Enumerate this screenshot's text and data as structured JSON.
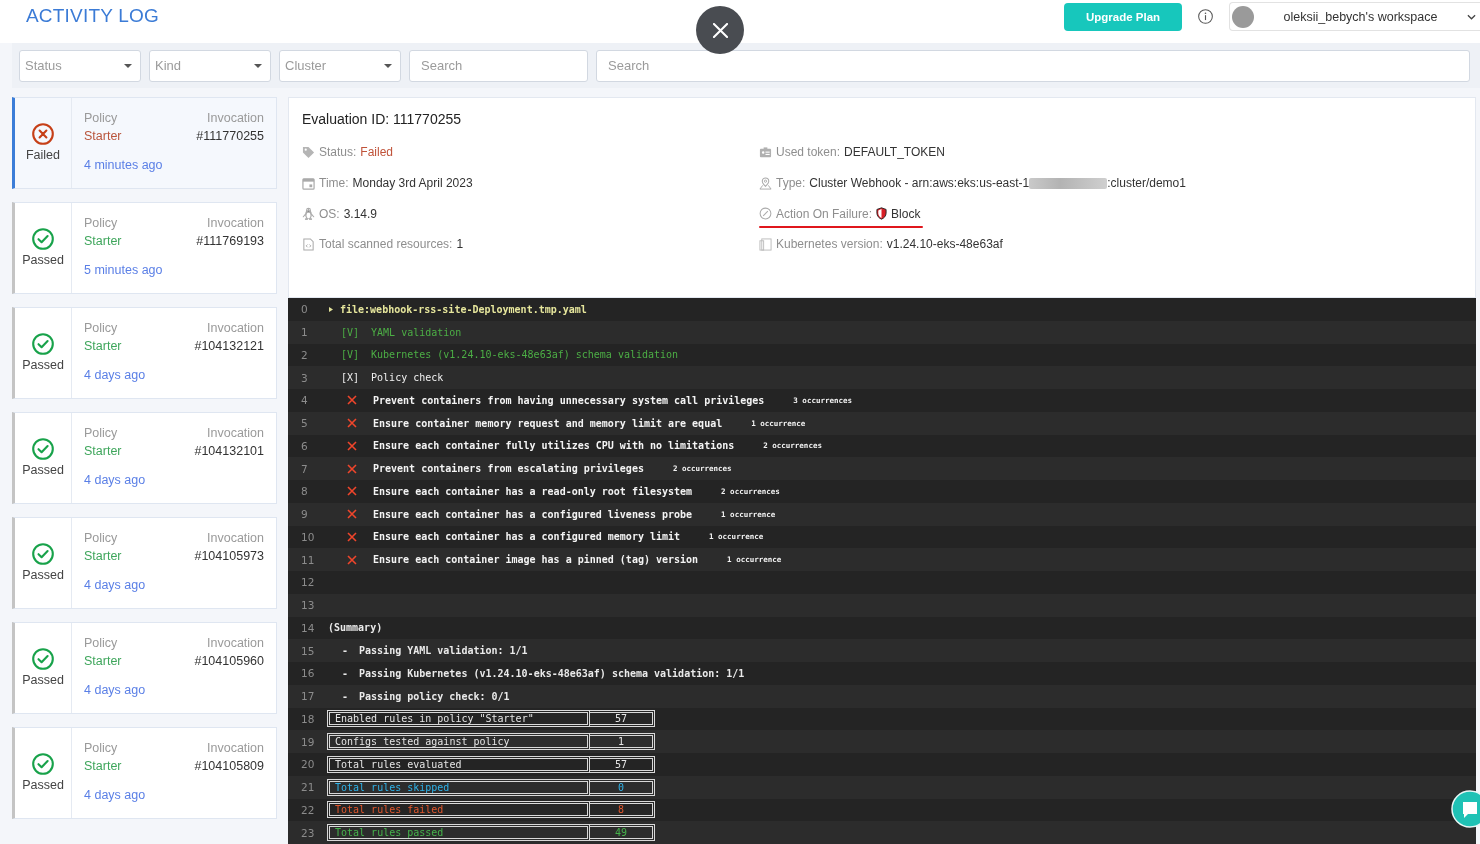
{
  "header": {
    "title": "ACTIVITY LOG",
    "upgrade_button": "Upgrade Plan",
    "workspace": "oleksii_bebych's workspace"
  },
  "filters": [
    {
      "kind": "select",
      "placeholder": "Status"
    },
    {
      "kind": "select",
      "placeholder": "Kind"
    },
    {
      "kind": "select",
      "placeholder": "Cluster"
    },
    {
      "kind": "search",
      "placeholder": "Search"
    },
    {
      "kind": "search",
      "placeholder": "Search"
    }
  ],
  "evaluations": [
    {
      "kind": "failed",
      "status_label": "Failed",
      "policy_label": "Policy",
      "policy": "Starter",
      "invocation_label": "Invocation",
      "invocation": "#111770255",
      "time": "4 minutes ago",
      "selected": true
    },
    {
      "kind": "passed",
      "status_label": "Passed",
      "policy_label": "Policy",
      "policy": "Starter",
      "invocation_label": "Invocation",
      "invocation": "#111769193",
      "time": "5 minutes ago",
      "selected": false
    },
    {
      "kind": "passed",
      "status_label": "Passed",
      "policy_label": "Policy",
      "policy": "Starter",
      "invocation_label": "Invocation",
      "invocation": "#104132121",
      "time": "4 days ago",
      "selected": false
    },
    {
      "kind": "passed",
      "status_label": "Passed",
      "policy_label": "Policy",
      "policy": "Starter",
      "invocation_label": "Invocation",
      "invocation": "#104132101",
      "time": "4 days ago",
      "selected": false
    },
    {
      "kind": "passed",
      "status_label": "Passed",
      "policy_label": "Policy",
      "policy": "Starter",
      "invocation_label": "Invocation",
      "invocation": "#104105973",
      "time": "4 days ago",
      "selected": false
    },
    {
      "kind": "passed",
      "status_label": "Passed",
      "policy_label": "Policy",
      "policy": "Starter",
      "invocation_label": "Invocation",
      "invocation": "#104105960",
      "time": "4 days ago",
      "selected": false
    },
    {
      "kind": "passed",
      "status_label": "Passed",
      "policy_label": "Policy",
      "policy": "Starter",
      "invocation_label": "Invocation",
      "invocation": "#104105809",
      "time": "4 days ago",
      "selected": false
    }
  ],
  "details": {
    "title": "Evaluation ID: 111770255",
    "columns": [
      [
        {
          "kind": "status",
          "label": "Status:",
          "value": "Failed"
        },
        {
          "kind": "time",
          "label": "Time:",
          "value": "Monday 3rd April 2023"
        },
        {
          "kind": "os",
          "label": "OS:",
          "value": "3.14.9"
        },
        {
          "kind": "resources",
          "label": "Total scanned resources:",
          "value": "1"
        }
      ],
      [
        {
          "kind": "token",
          "label": "Used token:",
          "value": "DEFAULT_TOKEN"
        },
        {
          "kind": "type",
          "label": "Type:",
          "value": "Cluster Webhook - arn:aws:eks:us-east-1",
          "redacted": true,
          "value_suffix": ":cluster/demo1"
        },
        {
          "kind": "action",
          "label": "Action On Failure:",
          "value": "Block",
          "underlined": true
        },
        {
          "kind": "version",
          "label": "Kubernetes version:",
          "value": "v1.24.10-eks-48e63af"
        }
      ]
    ]
  },
  "terminal": {
    "lines": [
      {
        "number": "0",
        "kind": "file",
        "text": "file:webhook-rss-site-Deployment.tmp.yaml"
      },
      {
        "number": "1",
        "kind": "check",
        "mark": "[V]",
        "passed": true,
        "text": "YAML validation"
      },
      {
        "number": "2",
        "kind": "check",
        "mark": "[V]",
        "passed": true,
        "text": "Kubernetes (v1.24.10-eks-48e63af) schema validation"
      },
      {
        "number": "3",
        "kind": "check",
        "mark": "[X]",
        "passed": false,
        "text": "Policy check"
      },
      {
        "number": "4",
        "kind": "failure",
        "text": "Prevent containers from having unnecessary system call privileges",
        "count": "3 occurrences"
      },
      {
        "number": "5",
        "kind": "failure",
        "text": "Ensure container memory request and memory limit are equal",
        "count": "1 occurrence"
      },
      {
        "number": "6",
        "kind": "failure",
        "text": "Ensure each container fully utilizes CPU with no limitations",
        "count": "2 occurrences"
      },
      {
        "number": "7",
        "kind": "failure",
        "text": "Prevent containers from escalating privileges",
        "count": "2 occurrences"
      },
      {
        "number": "8",
        "kind": "failure",
        "text": "Ensure each container has a read-only root filesystem",
        "count": "2 occurrences"
      },
      {
        "number": "9",
        "kind": "failure",
        "text": "Ensure each container has a configured liveness probe",
        "count": "1 occurrence"
      },
      {
        "number": "10",
        "kind": "failure",
        "text": "Ensure each container has a configured memory limit",
        "count": "1 occurrence"
      },
      {
        "number": "11",
        "kind": "failure",
        "text": "Ensure each container image has a pinned (tag) version",
        "count": "1 occurrence"
      },
      {
        "number": "12",
        "kind": "blank"
      },
      {
        "number": "13",
        "kind": "blank"
      },
      {
        "number": "14",
        "kind": "heading",
        "text": "(Summary)"
      },
      {
        "number": "15",
        "kind": "bullet",
        "bullet": "-",
        "text": "Passing YAML validation: 1/1"
      },
      {
        "number": "16",
        "kind": "bullet",
        "bullet": "-",
        "text": "Passing Kubernetes (v1.24.10-eks-48e63af) schema validation: 1/1"
      },
      {
        "number": "17",
        "kind": "bullet",
        "bullet": "-",
        "text": "Passing policy check: 0/1"
      },
      {
        "number": "18",
        "kind": "stat",
        "color": "#e6e6e6",
        "text": "Enabled rules in policy \"Starter\"",
        "value": "57"
      },
      {
        "number": "19",
        "kind": "stat",
        "color": "#e6e6e6",
        "text": "Configs tested against policy",
        "value": "1"
      },
      {
        "number": "20",
        "kind": "stat",
        "color": "#e6e6e6",
        "text": "Total rules evaluated",
        "value": "57"
      },
      {
        "number": "21",
        "kind": "stat",
        "color": "#2fb2e8",
        "text": "Total rules skipped",
        "value": "0"
      },
      {
        "number": "22",
        "kind": "stat",
        "color": "#e0562c",
        "text": "Total rules failed",
        "value": "8"
      },
      {
        "number": "23",
        "kind": "stat",
        "color": "#45b24b",
        "text": "Total rules passed",
        "value": "49"
      }
    ]
  }
}
